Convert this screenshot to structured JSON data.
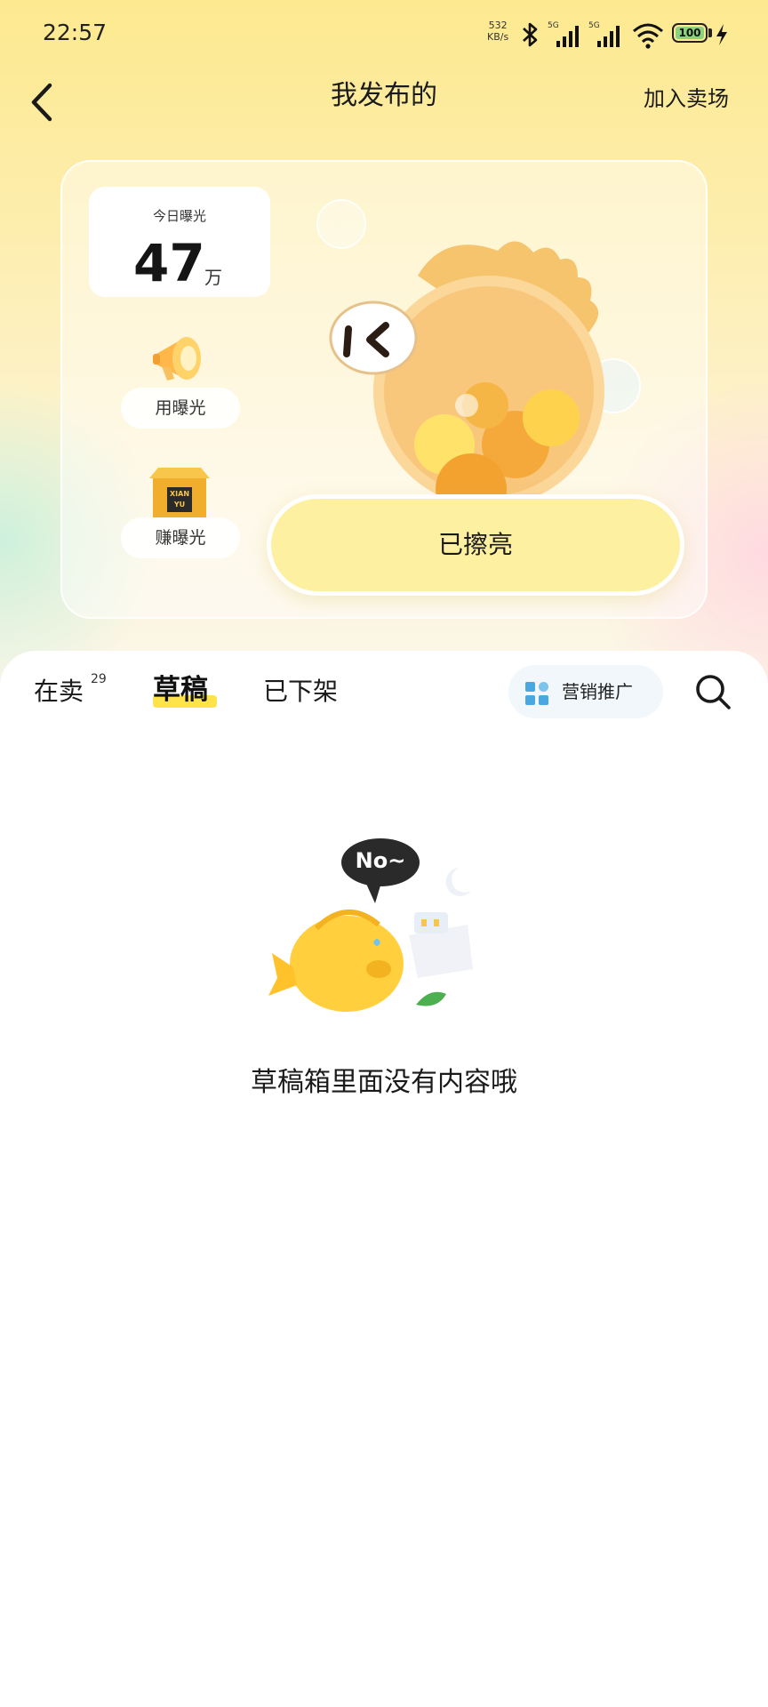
{
  "status_bar": {
    "time": "22:57",
    "speed_value": "532",
    "speed_unit": "KB/s",
    "network_1": "5G",
    "network_2": "5G",
    "battery": "100",
    "icons": [
      "bluetooth-icon",
      "signal-icon",
      "signal-icon",
      "wifi-icon",
      "battery-icon",
      "charging-icon"
    ]
  },
  "header": {
    "back_icon": "chevron-left-icon",
    "title": "我发布的",
    "action": "加入卖场"
  },
  "exposure_card": {
    "today_label": "今日曝光",
    "today_value": "47",
    "today_unit": "万",
    "use_exposure": "用曝光",
    "earn_exposure": "赚曝光",
    "box_text_1": "XIAN",
    "box_text_2": "YU",
    "polish_button": "已擦亮"
  },
  "tabs": [
    {
      "label": "在卖",
      "badge": "29",
      "active": false
    },
    {
      "label": "草稿",
      "active": true
    },
    {
      "label": "已下架",
      "active": false
    }
  ],
  "toolbar": {
    "promo_label": "营销推广",
    "promo_icon": "grid-icon",
    "search_icon": "search-icon"
  },
  "empty_state": {
    "bubble_text": "No~",
    "message": "草稿箱里面没有内容哦"
  },
  "colors": {
    "accent_yellow": "#ffe34a",
    "button_yellow": "#fdf0a0",
    "promo_blue": "#4aa8e0"
  }
}
